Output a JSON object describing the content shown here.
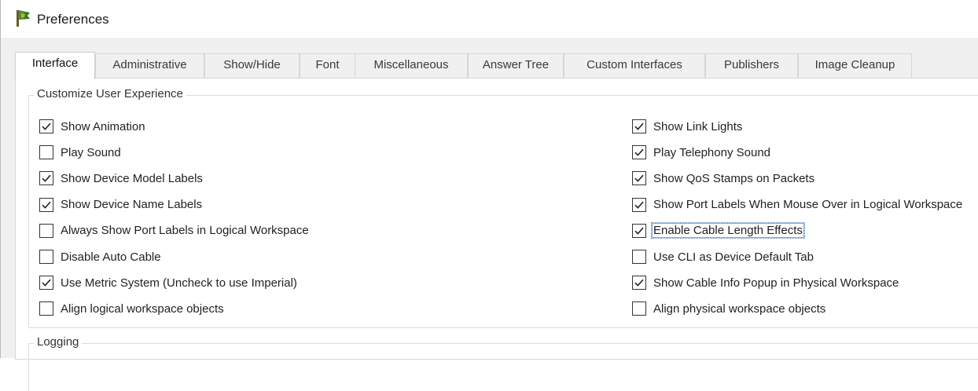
{
  "window": {
    "title": "Preferences"
  },
  "tabs": [
    {
      "label": "Interface",
      "active": true
    },
    {
      "label": "Administrative",
      "active": false
    },
    {
      "label": "Show/Hide",
      "active": false
    },
    {
      "label": "Font",
      "active": false
    },
    {
      "label": "Miscellaneous",
      "active": false
    },
    {
      "label": "Answer Tree",
      "active": false
    },
    {
      "label": "Custom Interfaces",
      "active": false
    },
    {
      "label": "Publishers",
      "active": false
    },
    {
      "label": "Image Cleanup",
      "active": false
    }
  ],
  "customize": {
    "title": "Customize User Experience",
    "left": [
      {
        "label": "Show Animation",
        "checked": true
      },
      {
        "label": "Play Sound",
        "checked": false
      },
      {
        "label": "Show Device Model Labels",
        "checked": true
      },
      {
        "label": "Show Device Name Labels",
        "checked": true
      },
      {
        "label": "Always Show Port Labels in Logical Workspace",
        "checked": false
      },
      {
        "label": "Disable Auto Cable",
        "checked": false
      },
      {
        "label": "Use Metric System (Uncheck to use Imperial)",
        "checked": true
      },
      {
        "label": "Align logical workspace objects",
        "checked": false
      }
    ],
    "right": [
      {
        "label": "Show Link Lights",
        "checked": true
      },
      {
        "label": "Play Telephony Sound",
        "checked": true
      },
      {
        "label": "Show QoS Stamps on Packets",
        "checked": true
      },
      {
        "label": "Show Port Labels When Mouse Over in Logical Workspace",
        "checked": true
      },
      {
        "label": "Enable Cable Length Effects",
        "checked": true,
        "focused": true
      },
      {
        "label": "Use CLI as Device Default Tab",
        "checked": false
      },
      {
        "label": "Show Cable Info Popup in Physical Workspace",
        "checked": true
      },
      {
        "label": "Align physical workspace objects",
        "checked": false
      }
    ]
  },
  "logging": {
    "title": "Logging"
  }
}
